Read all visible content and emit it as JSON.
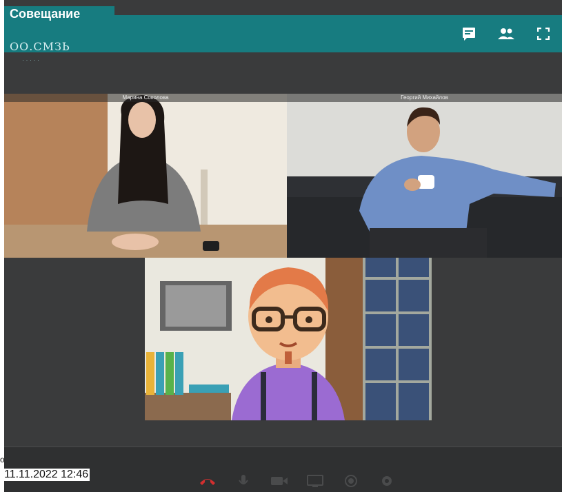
{
  "header": {
    "title": "Совещание",
    "subtitle": "ОО.СМЗЬ",
    "subtitle_dots": "· · · · ·",
    "icons": [
      "chat-icon",
      "participants-icon",
      "fullscreen-icon"
    ]
  },
  "participants": [
    {
      "name": "Марина Соколова"
    },
    {
      "name": "Георгий Михайлов"
    },
    {
      "name": ""
    }
  ],
  "controls": [
    "hangup-icon",
    "mic-icon",
    "camera-icon",
    "screen-share-icon",
    "record-icon",
    "settings-icon"
  ],
  "footer": {
    "timestamp": "11.11.2022 12:46",
    "edge_glyph": "о"
  },
  "colors": {
    "accent": "#177c80",
    "background": "#3a3b3c",
    "hangup": "#d32f2f"
  }
}
